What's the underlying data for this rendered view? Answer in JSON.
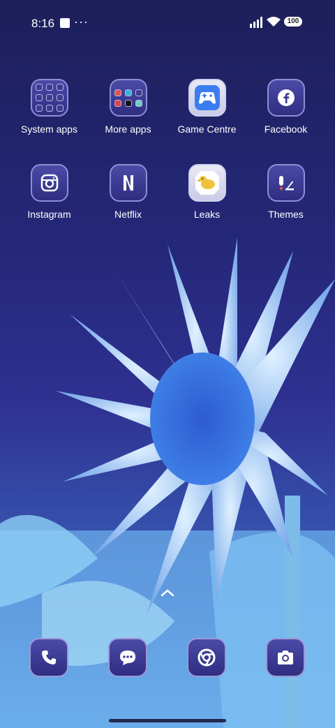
{
  "status_bar": {
    "time": "8:16",
    "overflow": "···",
    "battery": "100"
  },
  "apps": [
    {
      "label": "System apps",
      "icon": "folder-icon"
    },
    {
      "label": "More apps",
      "icon": "folder-icon"
    },
    {
      "label": "Game Centre",
      "icon": "gamepad-icon"
    },
    {
      "label": "Facebook",
      "icon": "facebook-icon"
    },
    {
      "label": "Instagram",
      "icon": "camera-icon"
    },
    {
      "label": "Netflix",
      "icon": "netflix-icon"
    },
    {
      "label": "Leaks",
      "icon": "bird-icon"
    },
    {
      "label": "Themes",
      "icon": "themes-icon"
    }
  ],
  "dock": [
    {
      "name": "phone-icon"
    },
    {
      "name": "messages-icon"
    },
    {
      "name": "chrome-icon"
    },
    {
      "name": "camera-icon"
    }
  ]
}
